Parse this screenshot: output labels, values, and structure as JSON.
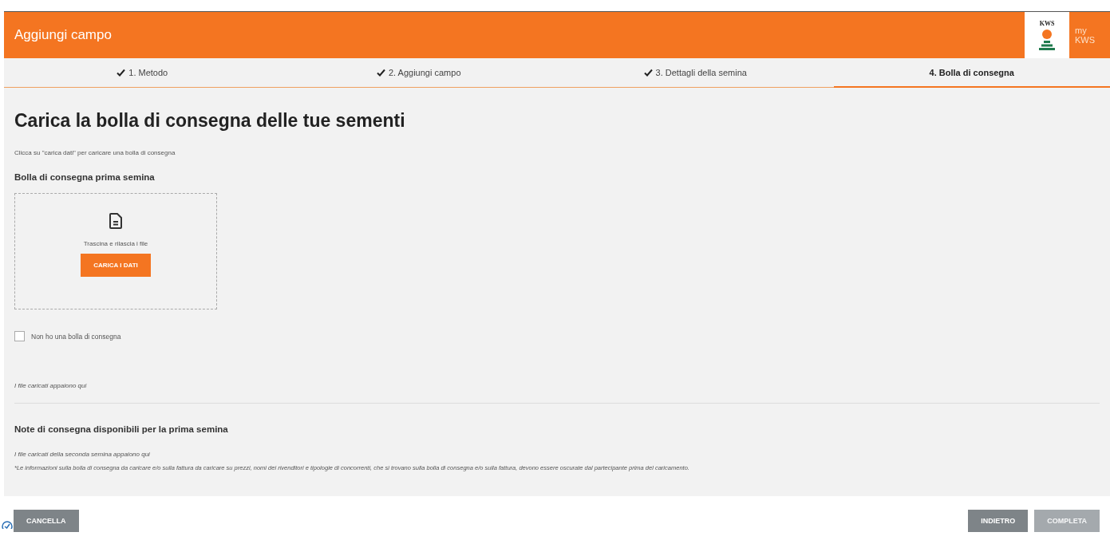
{
  "header": {
    "title": "Aggiungi campo",
    "logo_text": "KWS",
    "brand": "my\nKWS"
  },
  "steps": [
    {
      "label": "1. Metodo",
      "done": true,
      "selected": false
    },
    {
      "label": "2. Aggiungi campo",
      "done": true,
      "selected": false
    },
    {
      "label": "3. Dettagli della semina",
      "done": true,
      "selected": false
    },
    {
      "label": "4. Bolla di consegna",
      "done": false,
      "selected": true
    }
  ],
  "page_title": "Carica la bolla di consegna delle tue sementi",
  "intro": "Clicca su \"carica dati\" per caricare una bolla di consegna",
  "section_1": {
    "title": "Bolla di consegna prima semina",
    "dropzone": {
      "hint": "Trascina e rilascia i file",
      "button": "CARICA I DATI"
    },
    "checkbox": {
      "label": "Non ho una bolla di consegna",
      "checked": false
    },
    "files_note": "I file caricati appaiono qui"
  },
  "section_2": {
    "title": "Note di consegna disponibili per la prima semina",
    "files_note": "I file caricati della seconda semina appaiono qui",
    "disclaimer": "*Le informazioni sulla bolla di consegna da caricare e/o sulla fattura da caricare su prezzi, nomi dei rivenditori e tipologie di concorrenti, che si trovano sulla bolla di consegna e/o sulla fattura, devono essere oscurate dal partecipante prima del caricamento."
  },
  "footer": {
    "left": [
      {
        "label": "CANCELLA",
        "disabled": false
      }
    ],
    "right": [
      {
        "label": "INDIETRO",
        "disabled": false
      },
      {
        "label": "COMPLETA",
        "disabled": true
      }
    ]
  }
}
